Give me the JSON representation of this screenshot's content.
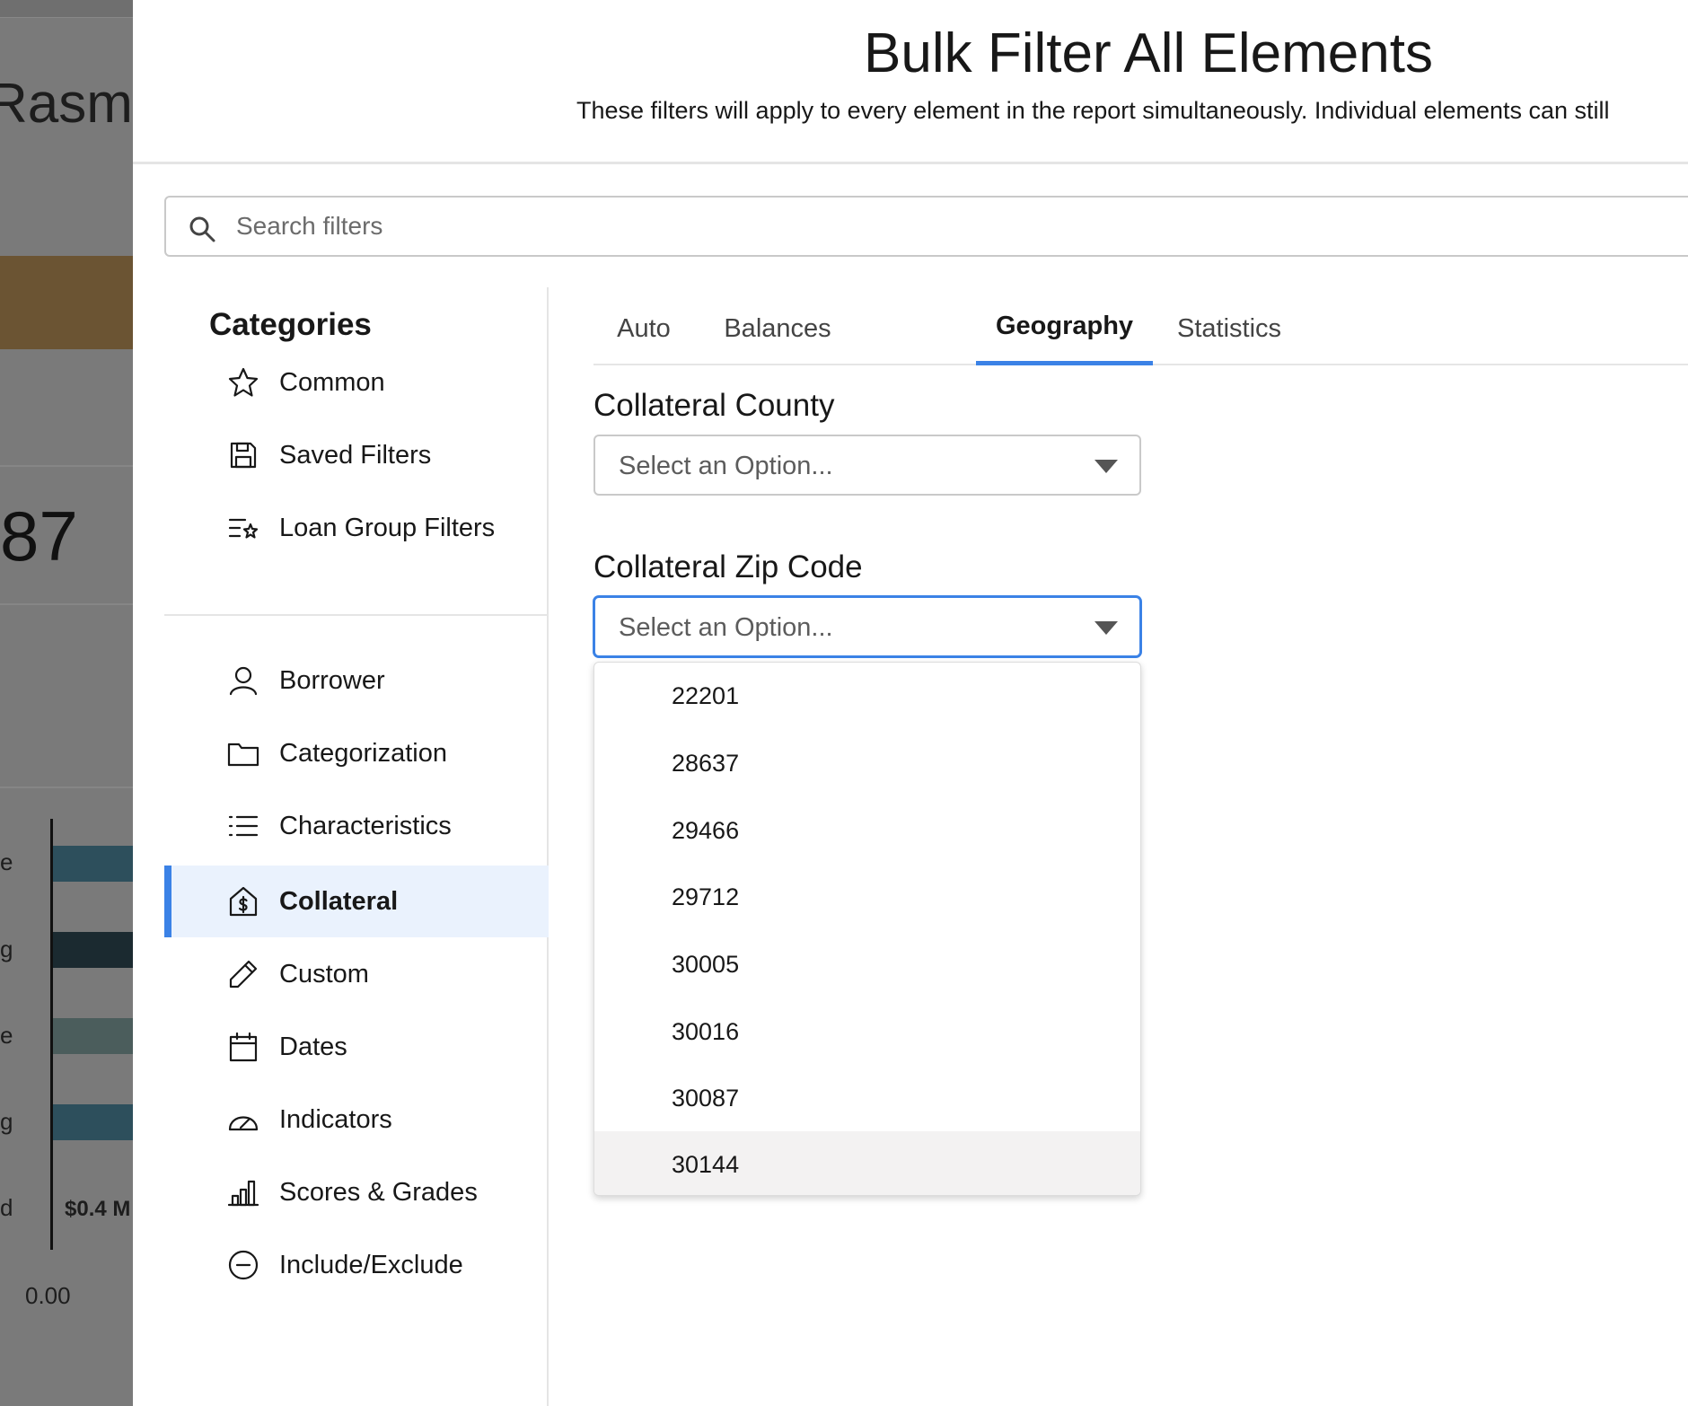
{
  "background": {
    "title_fragment": "Rasm",
    "big_number": "87",
    "chart_letters": [
      "e",
      "g",
      "e",
      "g",
      "d"
    ],
    "bar_colors": [
      "#2d4f5c",
      "#1b2a30",
      "#4b5d5c",
      "#2d4f5c"
    ],
    "money_label": "$0.4 M",
    "zero_label": "0.00"
  },
  "modal": {
    "title": "Bulk Filter All Elements",
    "subtitle": "These filters will apply to every element in the report simultaneously. Individual elements can still"
  },
  "search": {
    "placeholder": "Search filters",
    "value": ""
  },
  "sidebar": {
    "heading": "Categories",
    "top_items": [
      {
        "label": "Common",
        "icon": "star-icon"
      },
      {
        "label": "Saved Filters",
        "icon": "save-icon"
      },
      {
        "label": "Loan Group Filters",
        "icon": "list-star-icon"
      }
    ],
    "items": [
      {
        "label": "Borrower",
        "icon": "user-icon"
      },
      {
        "label": "Categorization",
        "icon": "folder-icon"
      },
      {
        "label": "Characteristics",
        "icon": "list-icon"
      },
      {
        "label": "Collateral",
        "icon": "house-dollar-icon",
        "active": true
      },
      {
        "label": "Custom",
        "icon": "pencil-icon"
      },
      {
        "label": "Dates",
        "icon": "calendar-icon"
      },
      {
        "label": "Indicators",
        "icon": "gauge-icon"
      },
      {
        "label": "Scores & Grades",
        "icon": "bar-chart-icon"
      },
      {
        "label": "Include/Exclude",
        "icon": "minus-circle-icon"
      }
    ]
  },
  "tabs": [
    {
      "label": "Auto"
    },
    {
      "label": "Balances"
    },
    {
      "label": "Geography",
      "active": true
    },
    {
      "label": "Statistics"
    }
  ],
  "fields": {
    "county": {
      "label": "Collateral County",
      "placeholder": "Select an Option..."
    },
    "zip": {
      "label": "Collateral Zip Code",
      "placeholder": "Select an Option..."
    }
  },
  "zip_options": [
    "22201",
    "28637",
    "29466",
    "29712",
    "30005",
    "30016",
    "30087",
    "30144"
  ],
  "colors": {
    "accent": "#3b82e6",
    "active_bg": "#eaf2fd",
    "hover_bg": "#f3f2f2"
  }
}
